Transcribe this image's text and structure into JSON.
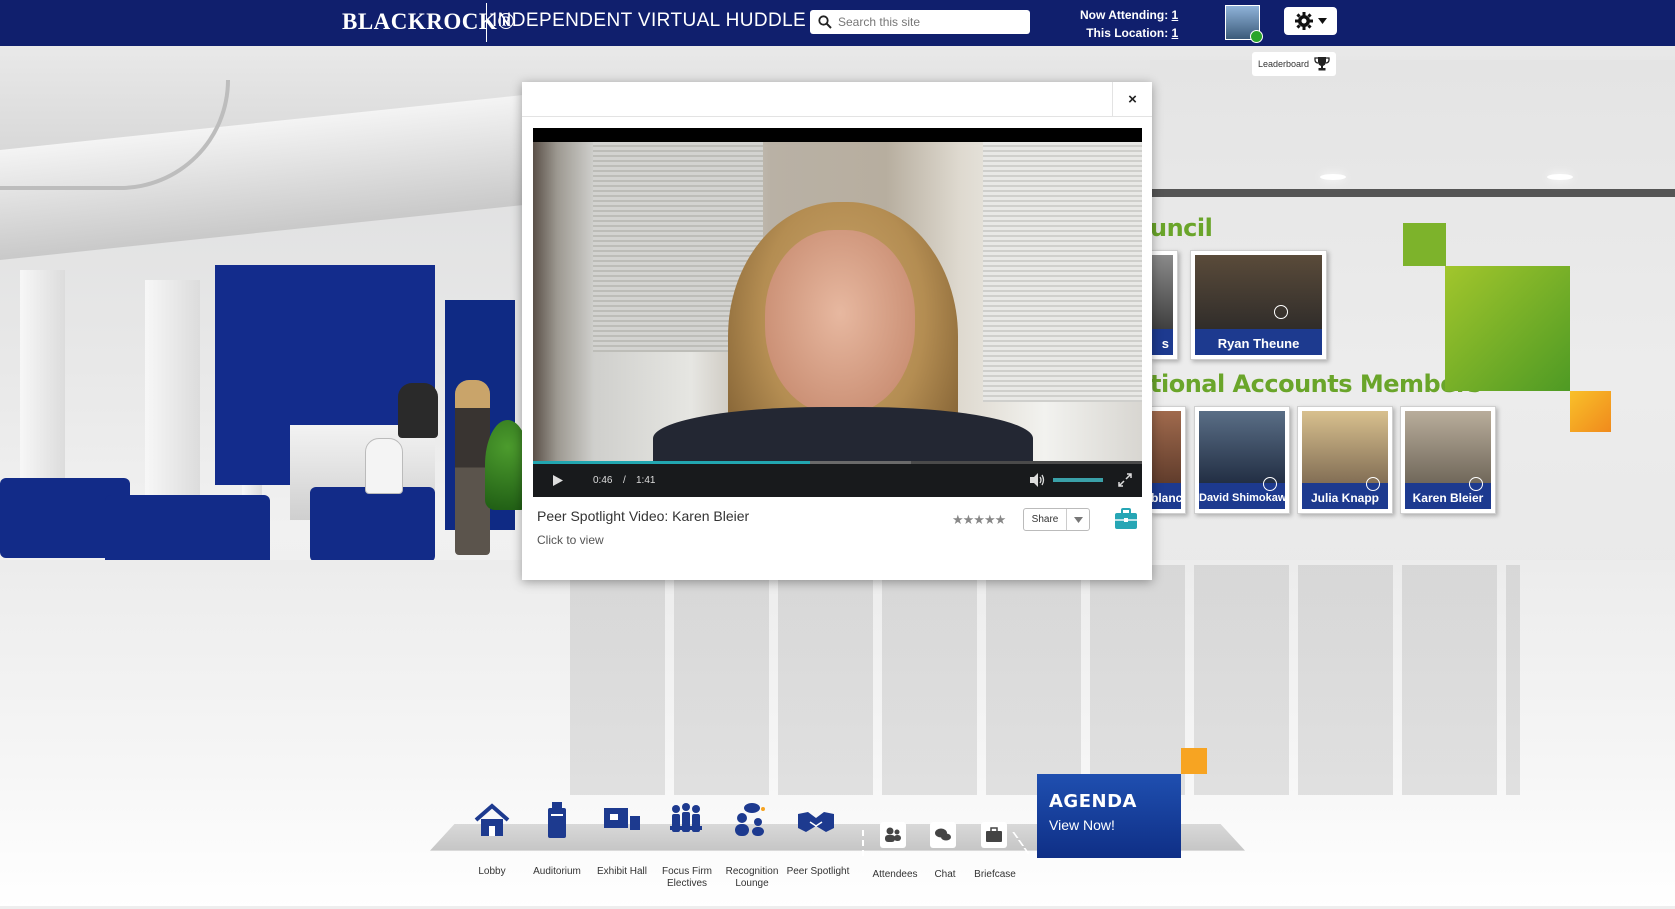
{
  "header": {
    "brand": "BLACKROCK®",
    "site_title": "INDEPENDENT VIRTUAL HUDDLE",
    "search_placeholder": "Search this site",
    "now_attending_label": "Now Attending:",
    "now_attending_value": "1",
    "this_location_label": "This Location:",
    "this_location_value": "1",
    "leaderboard_label": "Leaderboard"
  },
  "scene": {
    "heading_council": "uncil",
    "heading_national": "tional Accounts Members",
    "top_row": [
      {
        "name": "s"
      },
      {
        "name": "Ryan Theune"
      }
    ],
    "bottom_row": [
      {
        "name": "blanc"
      },
      {
        "name": "David Shimokawa"
      },
      {
        "name": "Julia Knapp"
      },
      {
        "name": "Karen Bleier"
      }
    ],
    "accent_colors": {
      "green": "#7db32b",
      "orange": "#f7a422",
      "navy": "#1d3a8f"
    }
  },
  "modal": {
    "close_label": "×",
    "video": {
      "current_time": "0:46",
      "separator": "/",
      "duration": "1:41",
      "progress_fraction": 0.455
    },
    "title": "Peer Spotlight Video: Karen Bleier",
    "subtitle": "Click to view",
    "rating_stars": "★★★★★",
    "share_label": "Share"
  },
  "nav": {
    "items": [
      {
        "label": "Lobby",
        "icon": "house-icon"
      },
      {
        "label": "Auditorium",
        "icon": "podium-icon"
      },
      {
        "label": "Exhibit Hall",
        "icon": "booth-icon"
      },
      {
        "label": "Focus Firm Electives",
        "icon": "people-group-icon"
      },
      {
        "label": "Recognition Lounge",
        "icon": "people-chat-icon"
      },
      {
        "label": "Peer Spotlight",
        "icon": "handshake-icon"
      }
    ],
    "tools": [
      {
        "label": "Attendees",
        "icon": "attendees-icon"
      },
      {
        "label": "Chat",
        "icon": "chat-icon"
      },
      {
        "label": "Briefcase",
        "icon": "briefcase-icon"
      }
    ],
    "agenda_title": "AGENDA",
    "agenda_sub": "View Now!"
  }
}
